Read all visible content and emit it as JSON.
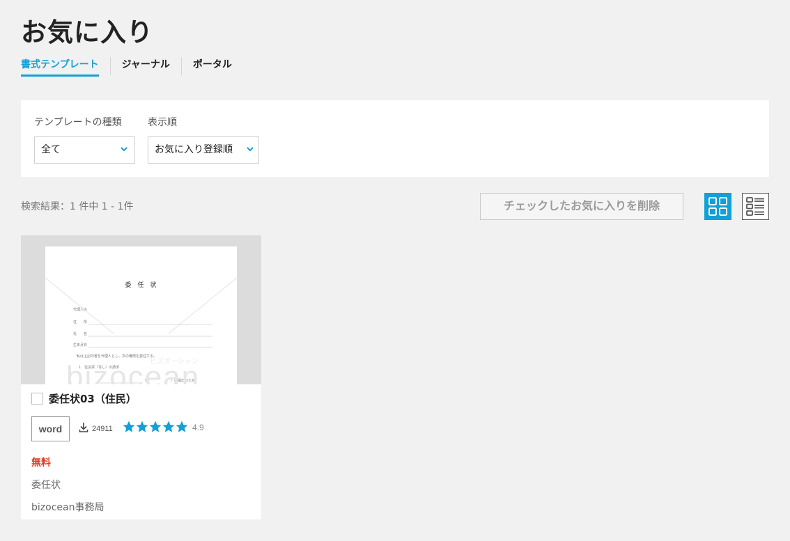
{
  "page": {
    "title": "お気に入り"
  },
  "tabs": [
    {
      "label": "書式テンプレート",
      "active": true
    },
    {
      "label": "ジャーナル",
      "active": false
    },
    {
      "label": "ポータル",
      "active": false
    }
  ],
  "filters": {
    "type_label": "テンプレートの種類",
    "type_value": "全て",
    "sort_label": "表示順",
    "sort_value": "お気に入り登録順"
  },
  "results": {
    "count_text": "検索結果：1 件中 1 - 1件"
  },
  "toolbar": {
    "delete_label": "チェックしたお気に入りを削除",
    "view_grid_icon": "grid-view-icon",
    "view_list_icon": "list-view-icon",
    "active_view": "grid"
  },
  "cards": [
    {
      "title": "委任状03（住民）",
      "thumbnail": {
        "heading": "委　任　状",
        "lines": [
          "代理人の",
          "住　　所",
          "氏　　名",
          "生年月日",
          "私は上記の者を代理人とし、次の権限を委任する。",
          "1　住民票（写し）の請求",
          "（　　　　　　　）に提出のため"
        ],
        "watermark": "bizocean",
        "watermark_kana": "ビズオーシャン"
      },
      "format": "word",
      "downloads": "24911",
      "stars": 5,
      "rating": "4.9",
      "price": "無料",
      "category": "委任状",
      "author": "bizocean事務局"
    }
  ],
  "colors": {
    "accent": "#12a0d8",
    "price": "#e03c1c",
    "background": "#f1f1f1"
  }
}
